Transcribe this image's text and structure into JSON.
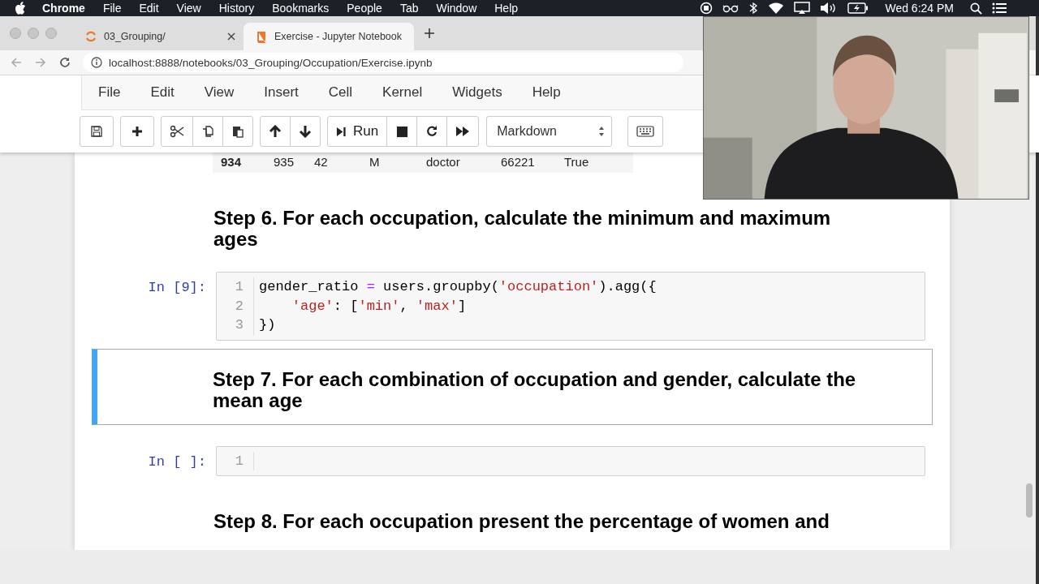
{
  "mac_menu_bar": {
    "app": "Chrome",
    "menus": [
      "File",
      "Edit",
      "View",
      "History",
      "Bookmarks",
      "People",
      "Tab",
      "Window",
      "Help"
    ],
    "clock": "Wed 6:24 PM"
  },
  "browser": {
    "tabs": [
      {
        "title": "03_Grouping/",
        "selected": false,
        "kind": "spinner"
      },
      {
        "title": "Exercise - Jupyter Notebook",
        "selected": true,
        "kind": "book"
      }
    ],
    "url": "localhost:8888/notebooks/03_Grouping/Occupation/Exercise.ipynb"
  },
  "jupyter": {
    "menus": [
      "File",
      "Edit",
      "View",
      "Insert",
      "Cell",
      "Kernel",
      "Widgets",
      "Help"
    ],
    "toolbar": [
      [
        {
          "kind": "save"
        }
      ],
      [
        {
          "kind": "add"
        }
      ],
      [
        {
          "kind": "cut"
        },
        {
          "kind": "copy"
        },
        {
          "kind": "paste"
        }
      ],
      [
        {
          "kind": "up"
        },
        {
          "kind": "down"
        }
      ],
      [
        {
          "kind": "run",
          "label": "Run"
        },
        {
          "kind": "stop"
        },
        {
          "kind": "restart"
        },
        {
          "kind": "fast-forward"
        }
      ]
    ],
    "cell_type": "Markdown"
  },
  "cells": [
    {
      "kind": "table_row",
      "index": "934",
      "values": [
        "935",
        "42",
        "M",
        "doctor",
        "66221",
        "True"
      ]
    },
    {
      "kind": "markdown",
      "text": "Step 6. For each occupation, calculate the minimum and maximum ages",
      "selected": false
    },
    {
      "kind": "code",
      "prompt": "In [9]:",
      "lines": [
        {
          "number": "1",
          "tokens": [
            {
              "kind": "plain",
              "text": "gender_ratio "
            },
            {
              "kind": "op",
              "text": "="
            },
            {
              "kind": "plain",
              "text": " users.groupby("
            },
            {
              "kind": "str",
              "text": "'occupation'"
            },
            {
              "kind": "plain",
              "text": ").agg({"
            }
          ]
        },
        {
          "number": "2",
          "tokens": [
            {
              "kind": "str",
              "text": "    'age'"
            },
            {
              "kind": "plain",
              "text": ": ["
            },
            {
              "kind": "str",
              "text": "'min'"
            },
            {
              "kind": "plain",
              "text": ", "
            },
            {
              "kind": "str",
              "text": "'max'"
            },
            {
              "kind": "plain",
              "text": "]"
            }
          ]
        },
        {
          "number": "3",
          "tokens": [
            {
              "kind": "plain",
              "text": "})"
            }
          ]
        }
      ]
    },
    {
      "kind": "markdown",
      "text": "Step 7. For each combination of occupation and gender, calculate the mean age",
      "selected": true
    },
    {
      "kind": "code",
      "prompt": "In [ ]:",
      "lines": [
        {
          "number": "1"
        }
      ]
    },
    {
      "kind": "markdown",
      "text": "Step 8. For each occupation present the percentage of women and",
      "selected": false
    }
  ]
}
